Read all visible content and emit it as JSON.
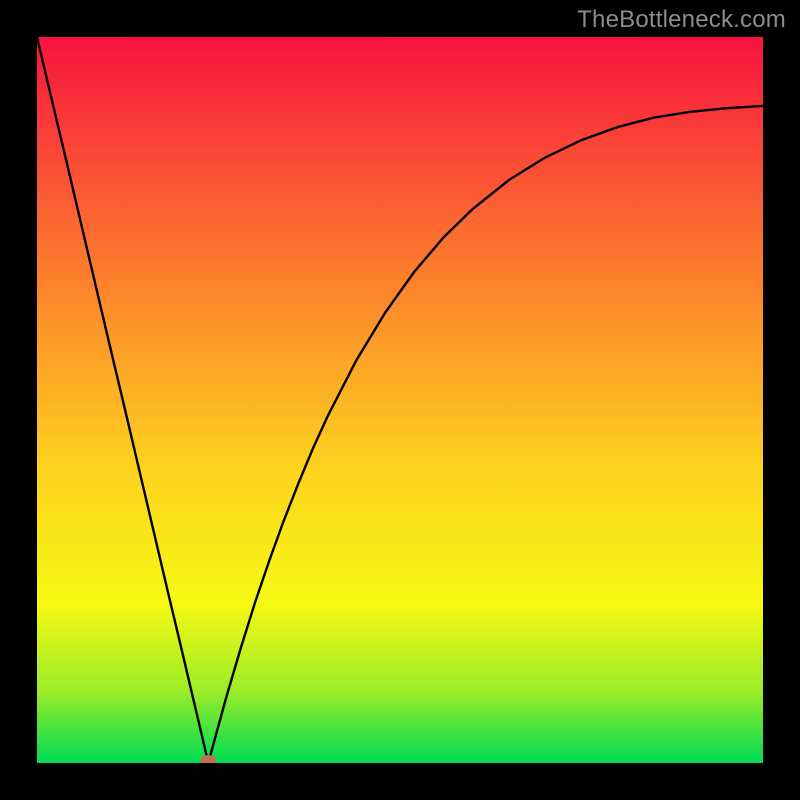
{
  "watermark": "TheBottleneck.com",
  "chart_data": {
    "type": "line",
    "title": "",
    "xlabel": "",
    "ylabel": "",
    "xlim": [
      0,
      100
    ],
    "ylim": [
      0,
      100
    ],
    "grid": false,
    "legend": false,
    "series": [
      {
        "name": "curve",
        "x": [
          0,
          2,
          4,
          6,
          8,
          10,
          12,
          14,
          16,
          18,
          20,
          22,
          23.6,
          24,
          26,
          28,
          30,
          32,
          34,
          36,
          38,
          40,
          44,
          48,
          52,
          56,
          60,
          65,
          70,
          75,
          80,
          85,
          90,
          95,
          100
        ],
        "y": [
          100,
          91.5,
          83.1,
          74.6,
          66.1,
          57.6,
          49.2,
          40.7,
          32.2,
          23.7,
          15.3,
          6.8,
          0.0,
          1.5,
          8.8,
          15.6,
          22.0,
          27.9,
          33.4,
          38.5,
          43.3,
          47.7,
          55.5,
          62.1,
          67.7,
          72.4,
          76.3,
          80.3,
          83.4,
          85.8,
          87.6,
          88.9,
          89.7,
          90.2,
          90.5
        ]
      }
    ],
    "marker": {
      "x": 23.6,
      "y": 0.0,
      "name": "optimum-point",
      "color": "#c56a54"
    },
    "gradient_stops": [
      {
        "pct": 0,
        "color": "#f7133e"
      },
      {
        "pct": 20,
        "color": "#fb5534"
      },
      {
        "pct": 40,
        "color": "#fd9629"
      },
      {
        "pct": 60,
        "color": "#fdd41e"
      },
      {
        "pct": 78,
        "color": "#f6f913"
      },
      {
        "pct": 90,
        "color": "#9ded27"
      },
      {
        "pct": 97,
        "color": "#2de047"
      },
      {
        "pct": 100,
        "color": "#01db54"
      }
    ]
  }
}
